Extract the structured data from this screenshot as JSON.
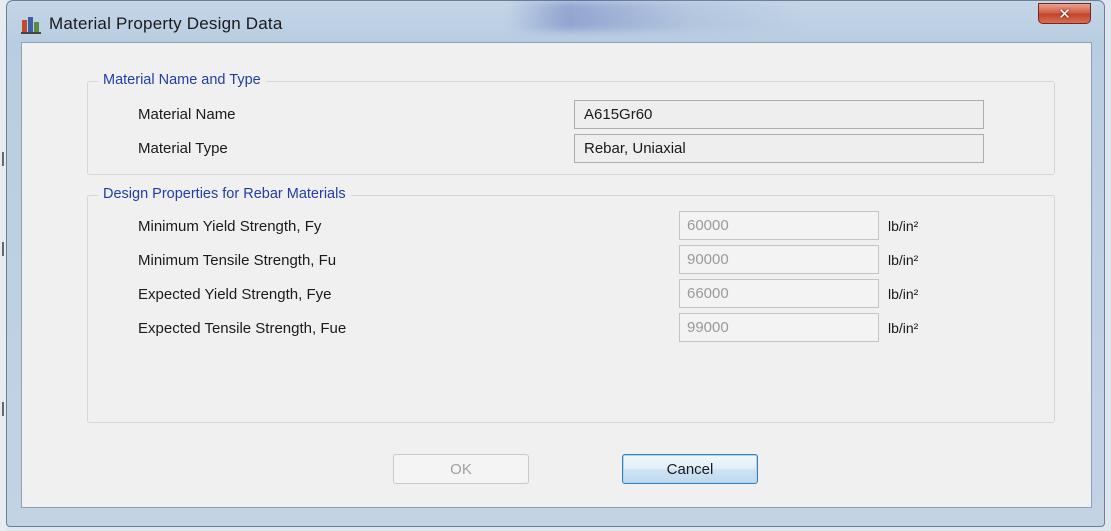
{
  "window": {
    "title": "Material Property Design Data",
    "close_glyph": "✕"
  },
  "group_material": {
    "label": "Material Name and Type",
    "name_label": "Material Name",
    "name_value": "A615Gr60",
    "type_label": "Material Type",
    "type_value": "Rebar, Uniaxial"
  },
  "group_design": {
    "label": "Design Properties for Rebar Materials",
    "rows": [
      {
        "label": "Minimum Yield Strength, Fy",
        "value": "60000",
        "unit": "lb/in²"
      },
      {
        "label": "Minimum Tensile Strength, Fu",
        "value": "90000",
        "unit": "lb/in²"
      },
      {
        "label": "Expected Yield Strength, Fye",
        "value": "66000",
        "unit": "lb/in²"
      },
      {
        "label": "Expected Tensile Strength, Fue",
        "value": "99000",
        "unit": "lb/in²"
      }
    ]
  },
  "buttons": {
    "ok": "OK",
    "cancel": "Cancel"
  },
  "icons": {
    "app": "application-icon",
    "close": "close-icon"
  }
}
